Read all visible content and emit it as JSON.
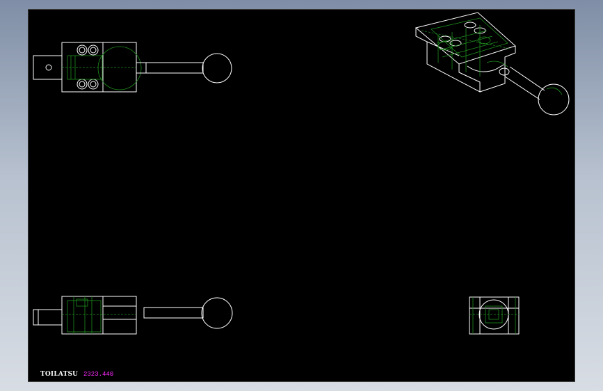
{
  "window": {
    "background_top": "#7f8ea6",
    "background_bottom": "#d8dde4"
  },
  "sheet": {
    "background_color": "#000000"
  },
  "colors": {
    "outline": "#ffffff",
    "hidden": "#1f8f1f",
    "annotation": "#ff2cff"
  },
  "title_block": {
    "company_text": "TOILATSU",
    "code_text": "2323.440"
  },
  "views": [
    {
      "name": "top-view"
    },
    {
      "name": "isometric-view"
    },
    {
      "name": "front-view"
    },
    {
      "name": "side-view"
    }
  ]
}
